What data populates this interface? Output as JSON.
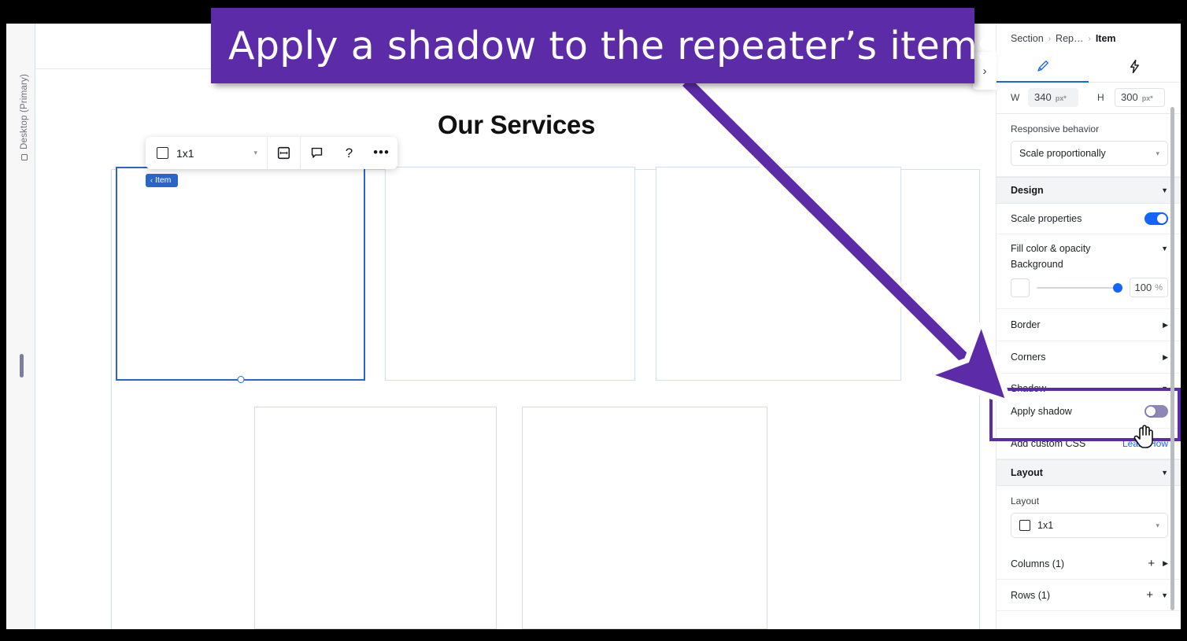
{
  "banner": {
    "text": "Apply a shadow to the repeater’s items"
  },
  "canvas": {
    "device_label": "Desktop (Primary)",
    "device_icon": "monitor-icon",
    "hero_title": "Our Services",
    "selection_badge": "Item",
    "selection_badge_chevron": "‹",
    "toolbar": {
      "layout_label": "1x1",
      "layout_icon": "square-icon",
      "dropdown_icon": "chevron-down-icon",
      "stretch_icon": "⬜",
      "comment_icon": "comment-icon",
      "help_label": "?",
      "more_label": "•••"
    },
    "collapse_arrow": "›"
  },
  "inspector": {
    "breadcrumb": {
      "parent": "Section",
      "middle": "Rep…",
      "current": "Item",
      "separator": "›"
    },
    "tabs": [
      {
        "name": "design-tab",
        "icon": "paintbrush-icon",
        "active": true
      },
      {
        "name": "interactions-tab",
        "icon": "lightning-bolt-icon",
        "active": false
      }
    ],
    "size": {
      "width_label": "W",
      "width_value": "340",
      "width_unit": "px*",
      "height_label": "H",
      "height_value": "300",
      "height_unit": "px*"
    },
    "responsive": {
      "label": "Responsive behavior",
      "value": "Scale proportionally",
      "dropdown_icon": "chevron-down-icon"
    },
    "design_section": {
      "title": "Design",
      "caret": "▼",
      "scale_properties": {
        "label": "Scale properties",
        "state": "on"
      },
      "fill": {
        "title": "Fill color & opacity",
        "caret": "▼",
        "background_label": "Background",
        "opacity_value": "100",
        "opacity_unit": "%"
      },
      "border": {
        "label": "Border",
        "caret": "▶"
      },
      "corners": {
        "label": "Corners",
        "caret": "▶"
      },
      "shadow": {
        "label": "Shadow",
        "caret": "▼",
        "apply_label": "Apply shadow",
        "apply_state": "off",
        "highlighted": true,
        "highlight_color": "#5b2ba8"
      },
      "custom_css": {
        "label": "Add custom CSS",
        "link": "Learn How"
      }
    },
    "layout_section": {
      "title": "Layout",
      "caret": "▼",
      "layout_label": "Layout",
      "layout_value": "1x1",
      "layout_icon": "square-icon",
      "dropdown_icon": "chevron-down-icon",
      "columns": {
        "label": "Columns (1)",
        "add": "+",
        "caret": "▶"
      },
      "rows": {
        "label": "Rows (1)",
        "add": "+",
        "caret": "▼"
      }
    }
  },
  "colors": {
    "accent_blue": "#1464ff",
    "selection_blue": "#2a66c8",
    "highlight_purple": "#5b2ba8",
    "panel_bg": "#ffffff"
  }
}
